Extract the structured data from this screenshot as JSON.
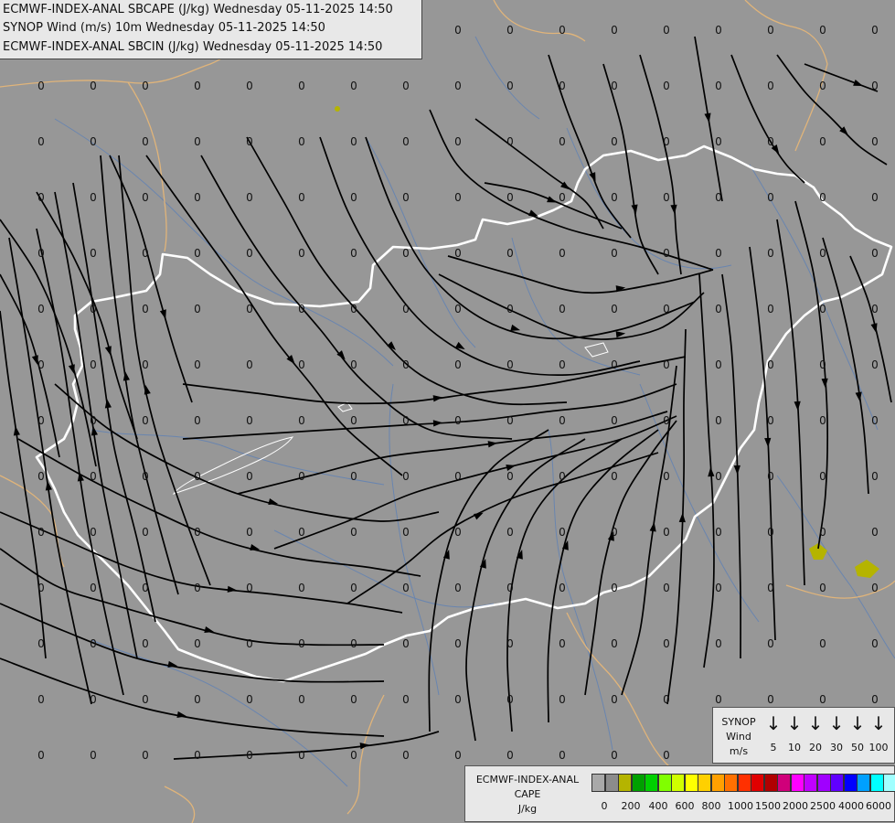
{
  "header": {
    "line1": "ECMWF-INDEX-ANAL SBCAPE (J/kg) Wednesday 05-11-2025 14:50",
    "line2": "SYNOP Wind (m/s) 10m Wednesday 05-11-2025 14:50",
    "line3": "ECMWF-INDEX-ANAL SBCIN (J/kg) Wednesday 05-11-2025 14:50"
  },
  "map": {
    "value_label": "0",
    "background_color": "#979797",
    "border_color": "#ffffff",
    "neighbor_border_color": "#e0b47a",
    "river_color": "#5a7fb8",
    "streamline_color": "#000000",
    "cape_patch_color": "#b5b400"
  },
  "wind_legend": {
    "title_lines": [
      "SYNOP",
      "Wind",
      "m/s"
    ],
    "values": [
      "5",
      "10",
      "20",
      "30",
      "50",
      "100"
    ],
    "arrow_icon": "down-arrow-icon"
  },
  "cape_legend": {
    "title_lines": [
      "ECMWF-INDEX-ANAL",
      "CAPE",
      "J/kg"
    ],
    "colors": [
      "#a9a9a9",
      "#8c8c8c",
      "#b5b400",
      "#00a000",
      "#00d000",
      "#80ff00",
      "#d0ff00",
      "#ffff00",
      "#ffd000",
      "#ffa000",
      "#ff7000",
      "#ff3000",
      "#e00000",
      "#b00000",
      "#d0007a",
      "#ff00ff",
      "#c000ff",
      "#a000ff",
      "#6000ff",
      "#0000ff",
      "#00a0ff",
      "#00ffff",
      "#a0ffff",
      "#ffffff"
    ],
    "labels": [
      "0",
      "200",
      "400",
      "600",
      "800",
      "1000",
      "1500",
      "2000",
      "2500",
      "4000",
      "6000"
    ]
  }
}
